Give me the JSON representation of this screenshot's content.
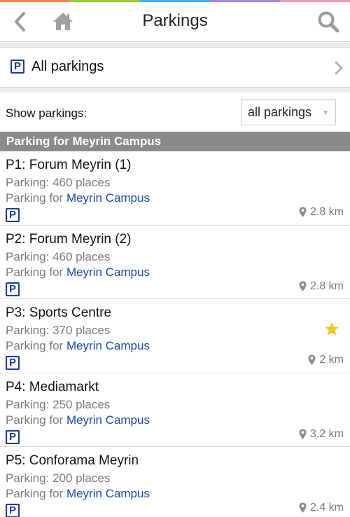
{
  "header": {
    "title": "Parkings",
    "back_icon": "chevron-left-icon",
    "home_icon": "home-icon",
    "search_icon": "search-icon",
    "stripe_colors": [
      "#f08a4b",
      "#9ccc3c",
      "#37b6e8",
      "#a18bd6",
      "#f0a0b8"
    ]
  },
  "all_parkings": {
    "icon_glyph": "P",
    "label": "All parkings"
  },
  "filter": {
    "label": "Show parkings:",
    "selected": "all parkings"
  },
  "section": {
    "title": "Parking for Meyrin Campus"
  },
  "parkings": [
    {
      "name": "P1: Forum Meyrin (1)",
      "places": "Parking: 460 places",
      "campus_prefix": "Parking for ",
      "campus_link": "Meyrin Campus",
      "distance": "2.8 km",
      "favorite": false,
      "icon_glyph": "P"
    },
    {
      "name": "P2: Forum Meyrin (2)",
      "places": "Parking: 460 places",
      "campus_prefix": "Parking for ",
      "campus_link": "Meyrin Campus",
      "distance": "2.8 km",
      "favorite": false,
      "icon_glyph": "P"
    },
    {
      "name": "P3: Sports Centre",
      "places": "Parking: 370 places",
      "campus_prefix": "Parking for ",
      "campus_link": "Meyrin Campus",
      "distance": "2 km",
      "favorite": true,
      "icon_glyph": "P"
    },
    {
      "name": "P4: Mediamarkt",
      "places": "Parking: 250 places",
      "campus_prefix": "Parking for ",
      "campus_link": "Meyrin Campus",
      "distance": "3.2 km",
      "favorite": false,
      "icon_glyph": "P"
    },
    {
      "name": "P5: Conforama Meyrin",
      "places": "Parking: 200 places",
      "campus_prefix": "Parking for ",
      "campus_link": "Meyrin Campus",
      "distance": "2.4 km",
      "favorite": false,
      "icon_glyph": "P"
    }
  ],
  "colors": {
    "link": "#1a4aa0",
    "parking_icon": "#1a3d8f",
    "star": "#f5c518",
    "section_bg": "#8a8a8a"
  }
}
